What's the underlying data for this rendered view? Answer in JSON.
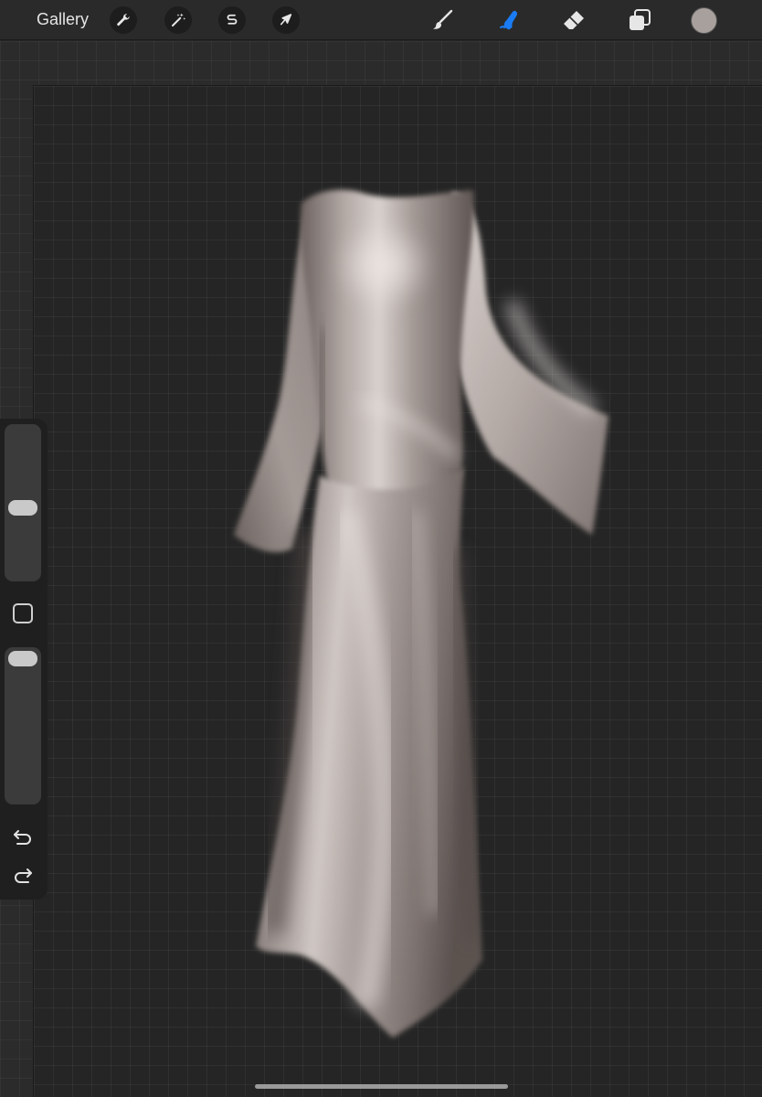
{
  "toolbar": {
    "gallery_label": "Gallery",
    "left_tools": [
      {
        "name": "actions",
        "icon": "wrench-icon"
      },
      {
        "name": "adjustments",
        "icon": "magic-wand-icon"
      },
      {
        "name": "selection",
        "icon": "selection-s-icon"
      },
      {
        "name": "transform",
        "icon": "arrow-cursor-icon"
      }
    ],
    "right_tools": [
      {
        "name": "brush",
        "icon": "brush-icon",
        "active": false
      },
      {
        "name": "smudge",
        "icon": "smudge-finger-icon",
        "active": true
      },
      {
        "name": "eraser",
        "icon": "eraser-icon",
        "active": false
      },
      {
        "name": "layers",
        "icon": "layers-icon",
        "active": false
      }
    ],
    "current_color": "#a8a09c",
    "active_color": "#1a7cf5"
  },
  "sidebar": {
    "brush_size_level": 0.42,
    "opacity_level": 0.97,
    "buttons": [
      "undo-icon",
      "redo-icon"
    ]
  }
}
